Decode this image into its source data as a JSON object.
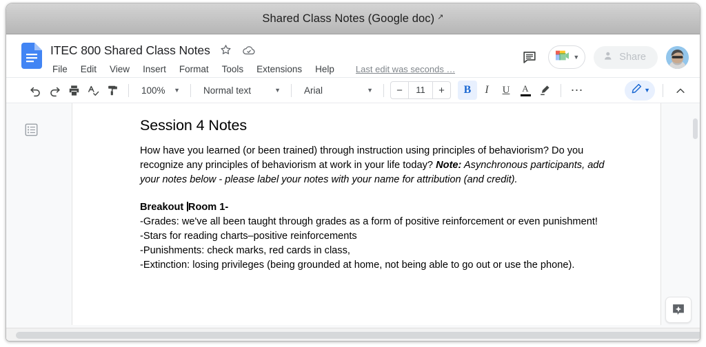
{
  "window": {
    "title": "Shared Class Notes (Google doc)",
    "external_link_icon": "external-link-icon"
  },
  "docs": {
    "doc_title": "ITEC 800 Shared Class Notes",
    "star_icon": "star-icon",
    "cloud_saved_icon": "cloud-done-icon",
    "menus": [
      "File",
      "Edit",
      "View",
      "Insert",
      "Format",
      "Tools",
      "Extensions",
      "Help"
    ],
    "last_edit": "Last edit was seconds …",
    "comment_history_icon": "comment-history-icon",
    "meet_icon": "google-meet-icon",
    "share_label": "Share",
    "share_icon": "person-add-icon",
    "avatar": "user-avatar"
  },
  "toolbar": {
    "undo_icon": "undo-icon",
    "redo_icon": "redo-icon",
    "print_icon": "print-icon",
    "spellcheck_icon": "spellcheck-icon",
    "paint_format_icon": "paint-format-icon",
    "zoom_value": "100%",
    "style_value": "Normal text",
    "font_value": "Arial",
    "font_size_decrease": "−",
    "font_size_value": "11",
    "font_size_increase": "+",
    "bold_label": "B",
    "italic_label": "I",
    "underline_label": "U",
    "text_color_label": "A",
    "text_color_swatch": "#000000",
    "highlight_icon": "highlight-pen-icon",
    "more_label": "⋯",
    "mode_icon": "edit-pencil-icon",
    "collapse_icon": "chevron-up-icon",
    "bold_active": true,
    "accent_color": "#1967d2",
    "accent_bg": "#e8f0fe"
  },
  "sidebar": {
    "outline_icon": "document-outline-icon"
  },
  "document": {
    "heading": "Session 4 Notes",
    "paragraph1_plain": "How have you learned (or been trained) through instruction using principles of behaviorism? Do you recognize any principles of behaviorism at work in your life today? ",
    "paragraph1_note_label": "Note:",
    "paragraph1_note_italic": " Asynchronous participants, add your notes below - please label your notes with your name for attribution (and credit).",
    "breakout_before_caret": "Breakout ",
    "breakout_after_caret": "Room 1-",
    "bullets": [
      "-Grades: we've all been taught through grades as a form of positive reinforcement or even punishment!",
      "-Stars for reading charts–positive reinforcements",
      "-Punishments: check marks, red cards in class,",
      "-Extinction: losing privileges (being grounded at home, not being able to go out or use the phone)."
    ]
  },
  "controls": {
    "vertical_scrollbar": "vertical-scrollbar",
    "horizontal_scrollbar": "horizontal-scrollbar",
    "assistant_icon": "comment-sparkle-icon"
  }
}
